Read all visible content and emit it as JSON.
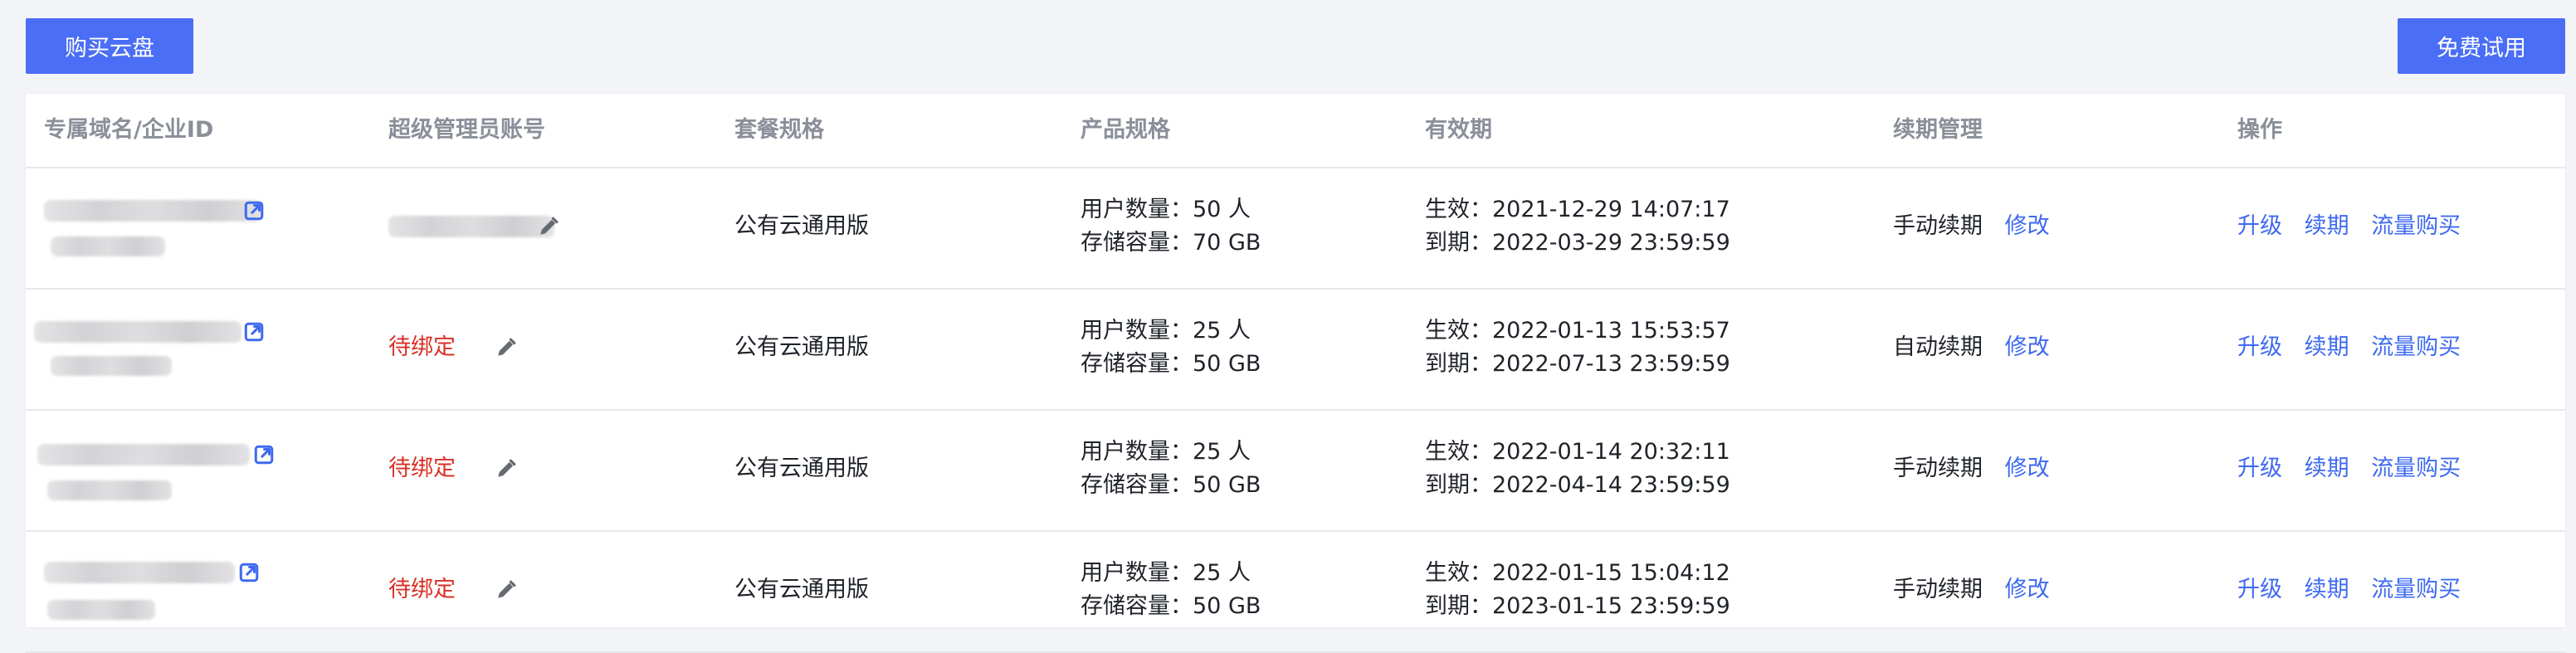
{
  "toolbar": {
    "buy_label": "购买云盘",
    "trial_label": "免费试用"
  },
  "table": {
    "headers": {
      "domain": "专属域名/企业ID",
      "admin": "超级管理员账号",
      "package": "套餐规格",
      "product": "产品规格",
      "validity": "有效期",
      "renewal": "续期管理",
      "actions": "操作"
    },
    "rows": [
      {
        "admin_status": "",
        "package": "公有云通用版",
        "users": "用户数量：50 人",
        "storage": "存储容量：70 GB",
        "start": "生效：2021-12-29 14:07:17",
        "end": "到期：2022-03-29 23:59:59",
        "renewal": "手动续期",
        "modify": "修改",
        "upgrade": "升级",
        "renew": "续期",
        "traffic": "流量购买"
      },
      {
        "admin_status": "待绑定",
        "package": "公有云通用版",
        "users": "用户数量：25 人",
        "storage": "存储容量：50 GB",
        "start": "生效：2022-01-13 15:53:57",
        "end": "到期：2022-07-13 23:59:59",
        "renewal": "自动续期",
        "modify": "修改",
        "upgrade": "升级",
        "renew": "续期",
        "traffic": "流量购买"
      },
      {
        "admin_status": "待绑定",
        "package": "公有云通用版",
        "users": "用户数量：25 人",
        "storage": "存储容量：50 GB",
        "start": "生效：2022-01-14 20:32:11",
        "end": "到期：2022-04-14 23:59:59",
        "renewal": "手动续期",
        "modify": "修改",
        "upgrade": "升级",
        "renew": "续期",
        "traffic": "流量购买"
      },
      {
        "admin_status": "待绑定",
        "package": "公有云通用版",
        "users": "用户数量：25 人",
        "storage": "存储容量：50 GB",
        "start": "生效：2022-01-15 15:04:12",
        "end": "到期：2023-01-15 23:59:59",
        "renewal": "手动续期",
        "modify": "修改",
        "upgrade": "升级",
        "renew": "续期",
        "traffic": "流量购买"
      }
    ]
  },
  "icons": {
    "external_link": "external-link-icon",
    "edit": "pencil-icon"
  },
  "colors": {
    "primary": "#4a6ef5",
    "link": "#3f6af0",
    "warning_text": "#d93026",
    "header_text": "#8a8f99"
  }
}
